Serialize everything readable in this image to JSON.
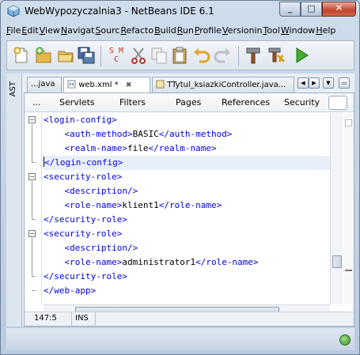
{
  "window": {
    "title": "WebWypozyczalnia3 - NetBeans IDE 6.1",
    "minimize": "_",
    "maximize": "□",
    "close": "✕"
  },
  "menu": [
    {
      "label": "File",
      "u": "F"
    },
    {
      "label": "Edit",
      "u": "E"
    },
    {
      "label": "View",
      "u": "V"
    },
    {
      "label": "Navigat",
      "u": "N"
    },
    {
      "label": "Sourc",
      "u": "S"
    },
    {
      "label": "Refacto",
      "u": "R"
    },
    {
      "label": "Build",
      "u": "B"
    },
    {
      "label": "Run",
      "u": "R"
    },
    {
      "label": "Profile",
      "u": "P"
    },
    {
      "label": "Versionin",
      "u": "V"
    },
    {
      "label": "Tool",
      "u": "T"
    },
    {
      "label": "Window",
      "u": "W"
    },
    {
      "label": "Help",
      "u": "H"
    }
  ],
  "toolbar": {
    "icons": [
      "new-file-icon",
      "new-project-icon",
      "open-project-icon",
      "save-all-icon",
      "smc-icon",
      "cut-icon",
      "copy-icon",
      "paste-icon",
      "undo-icon",
      "redo-icon",
      "build-icon",
      "clean-build-icon",
      "run-icon"
    ],
    "smc_top": "S M",
    "smc_bottom": "C"
  },
  "side": {
    "ast_label": "AST"
  },
  "tabs": [
    {
      "label": "...java"
    },
    {
      "label": "web.xml *"
    },
    {
      "label": "TTytul_ksiazkiController.java..."
    }
  ],
  "viewbar": {
    "items": [
      "...",
      "Servlets",
      "Filters",
      "Pages",
      "References",
      "Security"
    ]
  },
  "code": {
    "lines": [
      {
        "indent": "",
        "open": "<login-config>",
        "text": "",
        "close": ""
      },
      {
        "indent": "    ",
        "open": "<auth-method>",
        "text": "BASIC",
        "close": "</auth-method>"
      },
      {
        "indent": "    ",
        "open": "<realm-name>",
        "text": "file",
        "close": "</realm-name>"
      },
      {
        "indent": "",
        "open": "</login-config>",
        "text": "",
        "close": ""
      },
      {
        "indent": "",
        "open": "<security-role>",
        "text": "",
        "close": ""
      },
      {
        "indent": "    ",
        "open": "<description/>",
        "text": "",
        "close": ""
      },
      {
        "indent": "    ",
        "open": "<role-name>",
        "text": "klient1",
        "close": "</role-name>"
      },
      {
        "indent": "",
        "open": "</security-role>",
        "text": "",
        "close": ""
      },
      {
        "indent": "",
        "open": "<security-role>",
        "text": "",
        "close": ""
      },
      {
        "indent": "    ",
        "open": "<description/>",
        "text": "",
        "close": ""
      },
      {
        "indent": "    ",
        "open": "<role-name>",
        "text": "administrator1",
        "close": "</role-name>"
      },
      {
        "indent": "",
        "open": "</security-role>",
        "text": "",
        "close": ""
      },
      {
        "indent": "",
        "open": "</web-app>",
        "text": "",
        "close": ""
      }
    ],
    "highlighted_line": 3
  },
  "status": {
    "position": "147:5",
    "mode": "INS"
  },
  "colors": {
    "tag": "#0000e6",
    "text": "#000000",
    "highlight": "#e9eff8"
  }
}
